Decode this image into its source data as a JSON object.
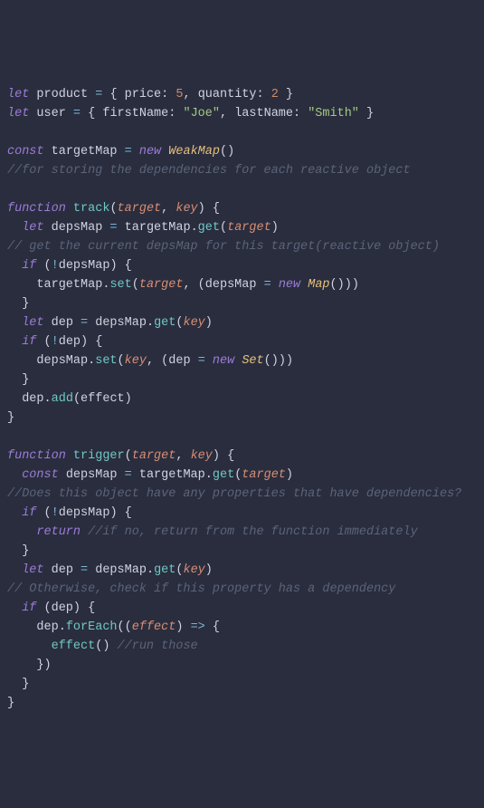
{
  "code": {
    "line1_let": "let",
    "line1_var": "product",
    "line1_eq": " = ",
    "line1_lb": "{ ",
    "line1_p1": "price",
    "line1_c1": ": ",
    "line1_v1": "5",
    "line1_cm": ", ",
    "line1_p2": "quantity",
    "line1_c2": ": ",
    "line1_v2": "2",
    "line1_rb": " }",
    "line2_let": "let",
    "line2_var": "user",
    "line2_eq": " = ",
    "line2_lb": "{ ",
    "line2_p1": "firstName",
    "line2_c1": ": ",
    "line2_v1": "\"Joe\"",
    "line2_cm": ", ",
    "line2_p2": "lastName",
    "line2_c2": ": ",
    "line2_v2": "\"Smith\"",
    "line2_rb": " }",
    "line4_const": "const",
    "line4_var": "targetMap",
    "line4_eq": " = ",
    "line4_new": "new",
    "line4_sp": " ",
    "line4_class": "WeakMap",
    "line4_paren": "()",
    "line5_comment": "//for storing the dependencies for each reactive object",
    "line7_func": "function",
    "line7_sp": " ",
    "line7_name": "track",
    "line7_lp": "(",
    "line7_p1": "target",
    "line7_cm": ", ",
    "line7_p2": "key",
    "line7_rp": ")",
    "line7_sp2": " ",
    "line7_lb": "{",
    "line8_ind": "  ",
    "line8_let": "let",
    "line8_var": " depsMap",
    "line8_eq": " = ",
    "line8_obj": "targetMap",
    "line8_dot": ".",
    "line8_method": "get",
    "line8_lp": "(",
    "line8_arg": "target",
    "line8_rp": ")",
    "line9_comment": "// get the current depsMap for this target(reactive object)",
    "line10_ind": "  ",
    "line10_if": "if",
    "line10_sp": " (",
    "line10_not": "!",
    "line10_var": "depsMap",
    "line10_rp": ") ",
    "line10_lb": "{",
    "line11_ind": "    ",
    "line11_obj": "targetMap",
    "line11_dot": ".",
    "line11_method": "set",
    "line11_lp": "(",
    "line11_a1": "target",
    "line11_cm": ", (",
    "line11_var": "depsMap",
    "line11_eq": " = ",
    "line11_new": "new",
    "line11_sp": " ",
    "line11_class": "Map",
    "line11_paren": "()))",
    "line12_ind": "  ",
    "line12_rb": "}",
    "line13_ind": "  ",
    "line13_let": "let",
    "line13_var": " dep",
    "line13_eq": " = ",
    "line13_obj": "depsMap",
    "line13_dot": ".",
    "line13_method": "get",
    "line13_lp": "(",
    "line13_arg": "key",
    "line13_rp": ")",
    "line14_ind": "  ",
    "line14_if": "if",
    "line14_sp": " (",
    "line14_not": "!",
    "line14_var": "dep",
    "line14_rp": ") ",
    "line14_lb": "{",
    "line15_ind": "    ",
    "line15_obj": "depsMap",
    "line15_dot": ".",
    "line15_method": "set",
    "line15_lp": "(",
    "line15_a1": "key",
    "line15_cm": ", (",
    "line15_var": "dep",
    "line15_eq": " = ",
    "line15_new": "new",
    "line15_sp": " ",
    "line15_class": "Set",
    "line15_paren": "()))",
    "line16_ind": "  ",
    "line16_rb": "}",
    "line17_ind": "  ",
    "line17_obj": "dep",
    "line17_dot": ".",
    "line17_method": "add",
    "line17_lp": "(",
    "line17_arg": "effect",
    "line17_rp": ")",
    "line18_rb": "}",
    "line20_func": "function",
    "line20_sp": " ",
    "line20_name": "trigger",
    "line20_lp": "(",
    "line20_p1": "target",
    "line20_cm": ", ",
    "line20_p2": "key",
    "line20_rp": ")",
    "line20_sp2": " ",
    "line20_lb": "{",
    "line21_ind": "  ",
    "line21_const": "const",
    "line21_var": " depsMap",
    "line21_eq": " = ",
    "line21_obj": "targetMap",
    "line21_dot": ".",
    "line21_method": "get",
    "line21_lp": "(",
    "line21_arg": "target",
    "line21_rp": ")",
    "line22_comment": "//Does this object have any properties that have dependencies?",
    "line23_ind": "  ",
    "line23_if": "if",
    "line23_sp": " (",
    "line23_not": "!",
    "line23_var": "depsMap",
    "line23_rp": ") ",
    "line23_lb": "{",
    "line24_ind": "    ",
    "line24_return": "return",
    "line24_sp": " ",
    "line24_comment": "//if no, return from the function immediately",
    "line25_ind": "  ",
    "line25_rb": "}",
    "line26_ind": "  ",
    "line26_let": "let",
    "line26_var": " dep",
    "line26_eq": " = ",
    "line26_obj": "depsMap",
    "line26_dot": ".",
    "line26_method": "get",
    "line26_lp": "(",
    "line26_arg": "key",
    "line26_rp": ")",
    "line27_comment": "// Otherwise, check if this property has a dependency",
    "line28_ind": "  ",
    "line28_if": "if",
    "line28_sp": " (",
    "line28_var": "dep",
    "line28_rp": ") ",
    "line28_lb": "{",
    "line29_ind": "    ",
    "line29_obj": "dep",
    "line29_dot": ".",
    "line29_method": "forEach",
    "line29_lp": "((",
    "line29_param": "effect",
    "line29_rp2": ")",
    "line29_arrow": " => ",
    "line29_lb": "{",
    "line30_ind": "      ",
    "line30_call": "effect",
    "line30_paren": "()",
    "line30_sp": " ",
    "line30_comment": "//run those",
    "line31_ind": "    ",
    "line31_rb": "})",
    "line32_ind": "  ",
    "line32_rb": "}",
    "line33_rb": "}"
  }
}
